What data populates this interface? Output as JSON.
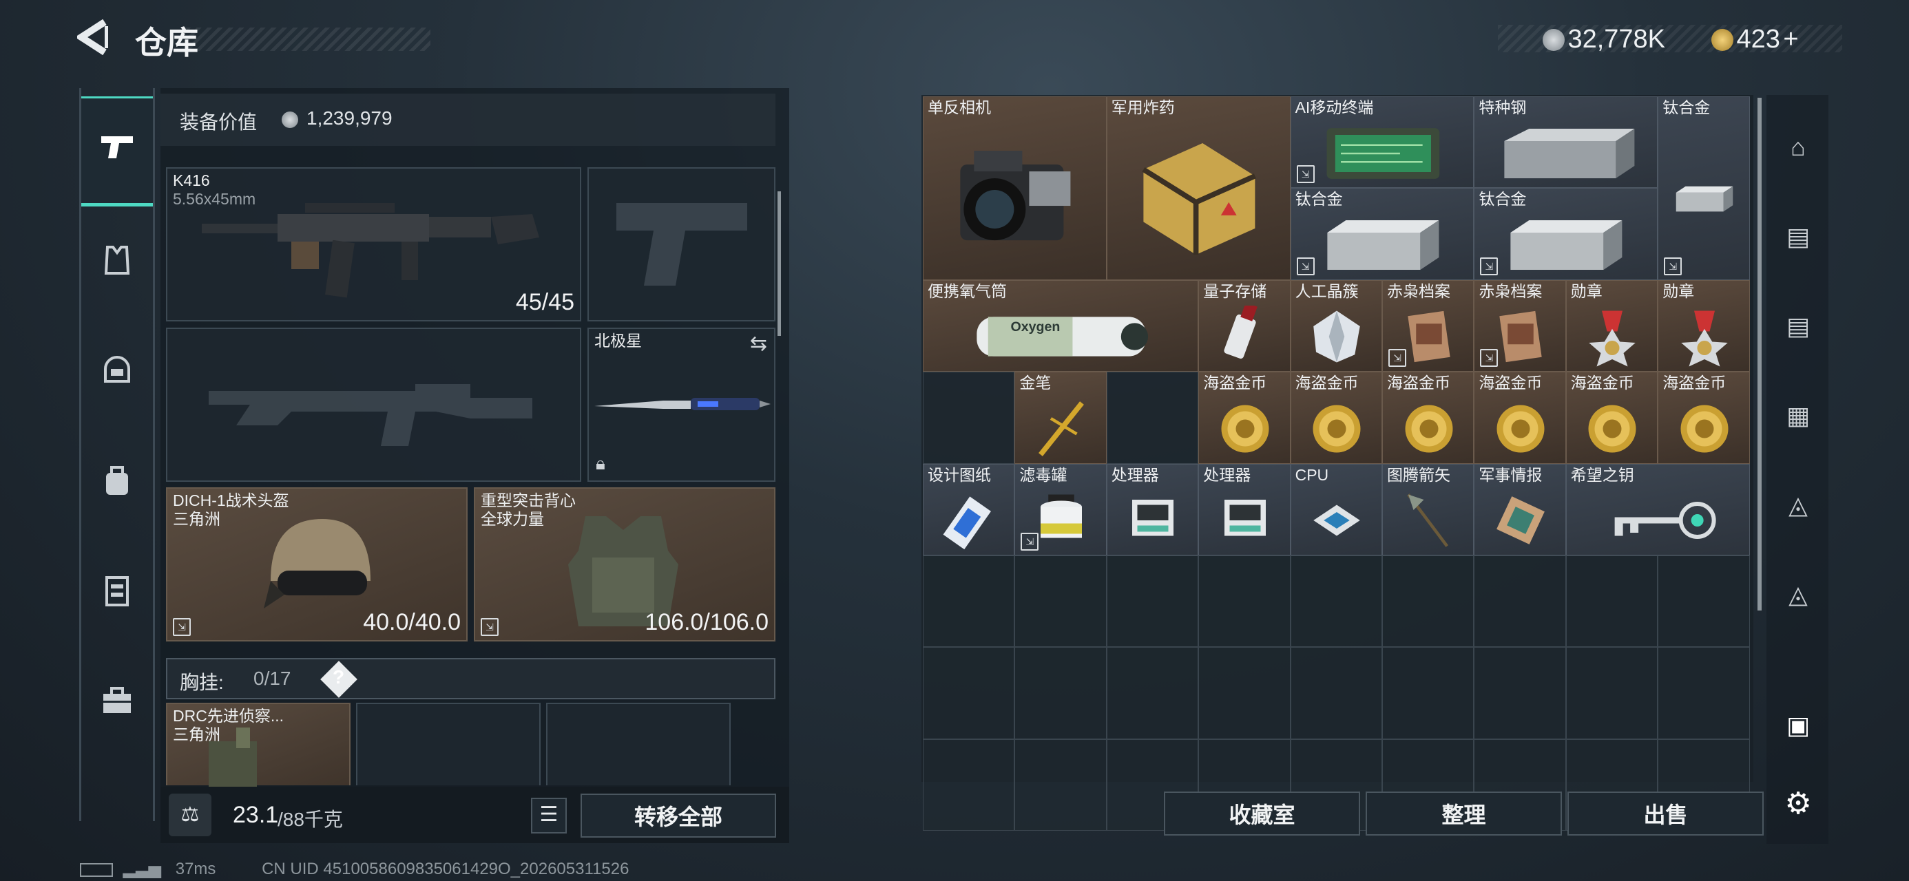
{
  "header": {
    "title": "仓库",
    "currency": [
      {
        "value": "32,778K"
      },
      {
        "value": "423",
        "suffix": "+"
      }
    ]
  },
  "loadout": {
    "value_label": "装备价值",
    "value": "1,239,979",
    "primary": {
      "name": "K416",
      "ammo_type": "5.56x45mm",
      "ammo": "45/45"
    },
    "melee": {
      "name": "北极星"
    },
    "helmet": {
      "name": "DICH-1战术头盔",
      "brand": "三角洲",
      "durability": "40.0/40.0"
    },
    "armor": {
      "name": "重型突击背心",
      "brand": "全球力量",
      "durability": "106.0/106.0"
    },
    "rig": {
      "label": "胸挂:",
      "count": "0/17",
      "help": "?"
    },
    "backpack": {
      "name": "DRC先进侦察...",
      "brand": "三角洲"
    },
    "weight": {
      "current": "23.1",
      "max": "/88千克"
    },
    "transfer_all": "转移全部"
  },
  "stash": {
    "items": [
      {
        "name": "单反相机",
        "icon": "camera"
      },
      {
        "name": "军用炸药",
        "icon": "explosive-crate"
      },
      {
        "name": "AI移动终端",
        "icon": "circuit-board"
      },
      {
        "name": "特种钢",
        "icon": "steel-ingot"
      },
      {
        "name": "钛合金",
        "icon": "ingot"
      },
      {
        "name": "钛合金",
        "icon": "ingot"
      },
      {
        "name": "钛合金",
        "icon": "ingot"
      },
      {
        "name": "便携氧气筒",
        "icon": "oxygen-tank",
        "art_text": "Oxygen"
      },
      {
        "name": "量子存储",
        "icon": "usb-drive"
      },
      {
        "name": "人工晶簇",
        "icon": "crystal"
      },
      {
        "name": "赤枭档案",
        "icon": "file"
      },
      {
        "name": "赤枭档案",
        "icon": "file"
      },
      {
        "name": "勋章",
        "icon": "medal"
      },
      {
        "name": "勋章",
        "icon": "medal"
      },
      {
        "name": "金笔",
        "icon": "pen"
      },
      {
        "name": "海盗金币",
        "icon": "coin"
      },
      {
        "name": "海盗金币",
        "icon": "coin"
      },
      {
        "name": "海盗金币",
        "icon": "coin"
      },
      {
        "name": "海盗金币",
        "icon": "coin"
      },
      {
        "name": "海盗金币",
        "icon": "coin"
      },
      {
        "name": "海盗金币",
        "icon": "coin"
      },
      {
        "name": "设计图纸",
        "icon": "blueprint"
      },
      {
        "name": "滤毒罐",
        "icon": "filter-canister"
      },
      {
        "name": "处理器",
        "icon": "processor"
      },
      {
        "name": "处理器",
        "icon": "processor"
      },
      {
        "name": "CPU",
        "icon": "cpu"
      },
      {
        "name": "图腾箭矢",
        "icon": "arrow"
      },
      {
        "name": "军事情报",
        "icon": "intel"
      },
      {
        "name": "希望之钥",
        "icon": "key"
      }
    ],
    "buttons": {
      "collection": "收藏室",
      "sort": "整理",
      "sell": "出售"
    }
  },
  "status": {
    "ping": "37ms",
    "uid": "CN UID 4510058609835061429O_202605311526"
  },
  "colors": {
    "accent": "#4ed9c3",
    "item_brown": "#5b4a3d",
    "coin_gold": "#d4a72c"
  }
}
